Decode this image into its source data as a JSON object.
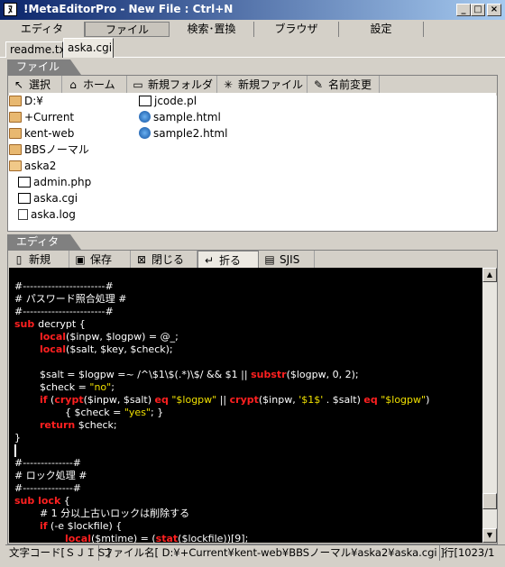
{
  "window": {
    "title": "!MetaEditorPro - New File : Ctrl+N",
    "icon": "editor-app-icon",
    "controls": {
      "minimize": "_",
      "maximize": "□",
      "close": "×"
    }
  },
  "menu": [
    {
      "label": "エディタ"
    },
    {
      "label": "ファイル"
    },
    {
      "label": "検索･置換"
    },
    {
      "label": "ブラウザ"
    },
    {
      "label": "設定"
    }
  ],
  "doc_tabs": [
    {
      "label": "readme.txt"
    },
    {
      "label": "aska.cgi"
    }
  ],
  "file_panel": {
    "tab_label": "ファイル",
    "toolbar": [
      {
        "label": "選択",
        "icon": "cursor-icon"
      },
      {
        "label": "ホーム",
        "icon": "home-icon"
      },
      {
        "label": "新規フォルダ",
        "icon": "new-folder-icon"
      },
      {
        "label": "新規ファイル",
        "icon": "new-file-icon"
      },
      {
        "label": "名前変更",
        "icon": "rename-icon"
      }
    ],
    "files_col1": [
      {
        "name": "D:¥",
        "type": "folder"
      },
      {
        "name": "+Current",
        "type": "folder"
      },
      {
        "name": "kent-web",
        "type": "folder"
      },
      {
        "name": "BBSノーマル",
        "type": "folder"
      },
      {
        "name": "aska2",
        "type": "folder-open"
      },
      {
        "name": "admin.php",
        "type": "script"
      },
      {
        "name": "aska.cgi",
        "type": "script"
      },
      {
        "name": "aska.log",
        "type": "text"
      }
    ],
    "files_col2": [
      {
        "name": "jcode.pl",
        "type": "script"
      },
      {
        "name": "sample.html",
        "type": "web"
      },
      {
        "name": "sample2.html",
        "type": "web"
      }
    ]
  },
  "editor_panel": {
    "tab_label": "エディタ",
    "toolbar": [
      {
        "label": "新規",
        "icon": "new-doc-icon"
      },
      {
        "label": "保存",
        "icon": "save-icon"
      },
      {
        "label": "閉じる",
        "icon": "close-doc-icon"
      },
      {
        "label": "折る",
        "icon": "wrap-icon"
      },
      {
        "label": "SJIS",
        "icon": "encoding-icon"
      }
    ],
    "code_lines": [
      [
        {
          "t": "#-----------------------#",
          "c": "w"
        }
      ],
      [
        {
          "t": "# パスワード照合処理 #",
          "c": "w"
        }
      ],
      [
        {
          "t": "#-----------------------#",
          "c": "w"
        }
      ],
      [
        {
          "t": "sub ",
          "c": "r"
        },
        {
          "t": "decrypt {",
          "c": "w"
        }
      ],
      [
        {
          "t": "        ",
          "c": "w"
        },
        {
          "t": "local",
          "c": "r"
        },
        {
          "t": "($inpw, $logpw) = @_;",
          "c": "w"
        }
      ],
      [
        {
          "t": "        ",
          "c": "w"
        },
        {
          "t": "local",
          "c": "r"
        },
        {
          "t": "($salt, $key, $check);",
          "c": "w"
        }
      ],
      [
        {
          "t": "",
          "c": "w"
        }
      ],
      [
        {
          "t": "        $salt = $logpw =~ /^\\$1\\$(.*)\\$/ && $1 || ",
          "c": "w"
        },
        {
          "t": "substr",
          "c": "r"
        },
        {
          "t": "($logpw, 0, 2);",
          "c": "w"
        }
      ],
      [
        {
          "t": "        $check = ",
          "c": "w"
        },
        {
          "t": "\"no\"",
          "c": "y"
        },
        {
          "t": ";",
          "c": "w"
        }
      ],
      [
        {
          "t": "        ",
          "c": "w"
        },
        {
          "t": "if",
          "c": "r"
        },
        {
          "t": " (",
          "c": "w"
        },
        {
          "t": "crypt",
          "c": "r"
        },
        {
          "t": "($inpw, $salt) ",
          "c": "w"
        },
        {
          "t": "eq",
          "c": "r"
        },
        {
          "t": " ",
          "c": "w"
        },
        {
          "t": "\"$logpw\"",
          "c": "y"
        },
        {
          "t": " || ",
          "c": "w"
        },
        {
          "t": "crypt",
          "c": "r"
        },
        {
          "t": "($inpw, ",
          "c": "w"
        },
        {
          "t": "'$1$'",
          "c": "y"
        },
        {
          "t": " . $salt) ",
          "c": "w"
        },
        {
          "t": "eq",
          "c": "r"
        },
        {
          "t": " ",
          "c": "w"
        },
        {
          "t": "\"$logpw\"",
          "c": "y"
        },
        {
          "t": ")",
          "c": "w"
        }
      ],
      [
        {
          "t": "                { $check = ",
          "c": "w"
        },
        {
          "t": "\"yes\"",
          "c": "y"
        },
        {
          "t": "; }",
          "c": "w"
        }
      ],
      [
        {
          "t": "        ",
          "c": "w"
        },
        {
          "t": "return",
          "c": "r"
        },
        {
          "t": " $check;",
          "c": "w"
        }
      ],
      [
        {
          "t": "}",
          "c": "w"
        }
      ],
      [
        {
          "t": "",
          "c": "w"
        }
      ],
      [
        {
          "t": "#--------------#",
          "c": "w"
        }
      ],
      [
        {
          "t": "# ロック処理 #",
          "c": "w"
        }
      ],
      [
        {
          "t": "#--------------#",
          "c": "w"
        }
      ],
      [
        {
          "t": "sub ",
          "c": "r"
        },
        {
          "t": "lock",
          "c": "r"
        },
        {
          "t": " {",
          "c": "w"
        }
      ],
      [
        {
          "t": "        # 1 分以上古いロックは削除する",
          "c": "w"
        }
      ],
      [
        {
          "t": "        ",
          "c": "w"
        },
        {
          "t": "if",
          "c": "r"
        },
        {
          "t": " (-e $lockfile) {",
          "c": "w"
        }
      ],
      [
        {
          "t": "                ",
          "c": "w"
        },
        {
          "t": "local",
          "c": "r"
        },
        {
          "t": "($mtime) = (",
          "c": "w"
        },
        {
          "t": "stat",
          "c": "r"
        },
        {
          "t": "($lockfile))[9];",
          "c": "w"
        }
      ]
    ]
  },
  "status": {
    "encoding": "文字コード[ＳＪＩＳ]",
    "filename": "ファイル名[ D:¥+Current¥kent-web¥BBSノーマル¥aska2¥aska.cgi ]",
    "line": "行[1023/1"
  }
}
